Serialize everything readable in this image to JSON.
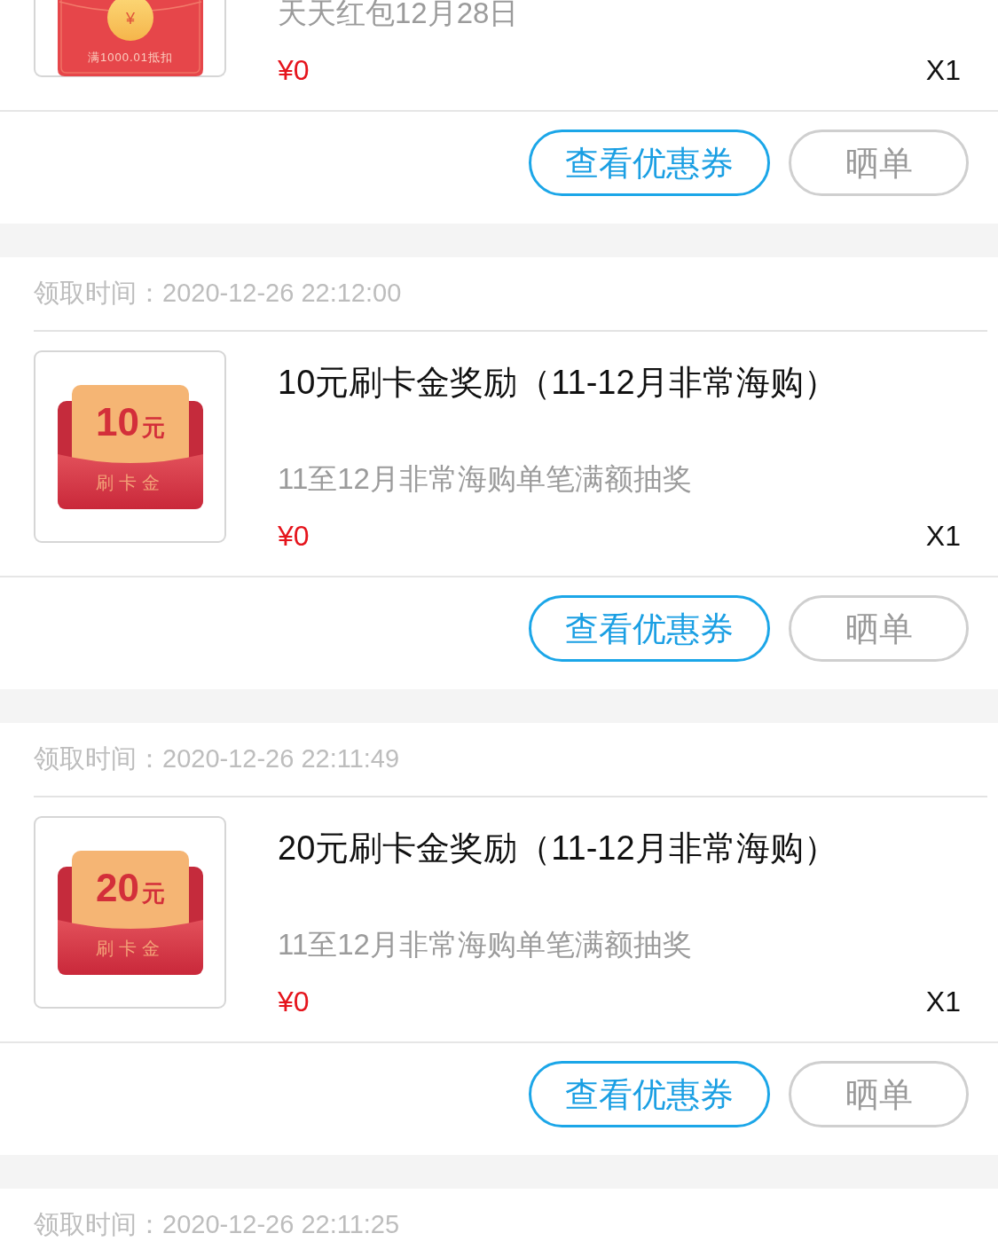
{
  "coupons": [
    {
      "description": "天天红包12月28日",
      "price": "¥0",
      "quantity": "X1",
      "thumbnail": {
        "kind": "red_packet",
        "coin": "¥",
        "caption": "满1000.01抵扣"
      },
      "buttons": [
        {
          "kind": "view_coupon",
          "label": "查看优惠券"
        },
        {
          "kind": "share_order",
          "label": "晒单"
        }
      ]
    },
    {
      "time": "领取时间：2020-12-26 22:12:00",
      "title": "10元刷卡金奖励（11-12月非常海购）",
      "description": "11至12月非常海购单笔满额抽奖",
      "price": "¥0",
      "quantity": "X1",
      "thumbnail": {
        "kind": "envelope",
        "amount": "10",
        "unit": "元",
        "caption": "刷卡金"
      },
      "buttons": [
        {
          "kind": "view_coupon",
          "label": "查看优惠券"
        },
        {
          "kind": "share_order",
          "label": "晒单"
        }
      ]
    },
    {
      "time": "领取时间：2020-12-26 22:11:49",
      "title": "20元刷卡金奖励（11-12月非常海购）",
      "description": "11至12月非常海购单笔满额抽奖",
      "price": "¥0",
      "quantity": "X1",
      "thumbnail": {
        "kind": "envelope",
        "amount": "20",
        "unit": "元",
        "caption": "刷卡金"
      },
      "buttons": [
        {
          "kind": "view_coupon",
          "label": "查看优惠券"
        },
        {
          "kind": "share_order",
          "label": "晒单"
        }
      ]
    },
    {
      "time": "领取时间：2020-12-26 22:11:25"
    }
  ]
}
